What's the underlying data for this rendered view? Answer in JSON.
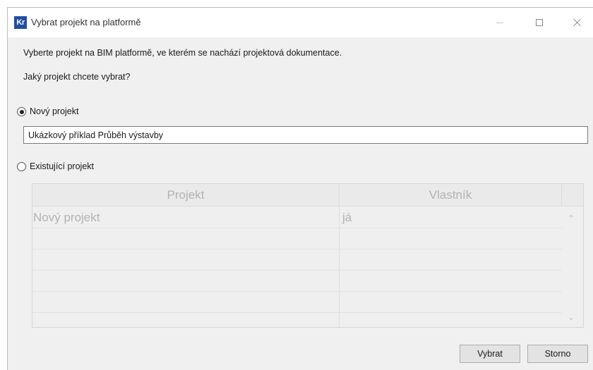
{
  "window": {
    "title": "Vybrat projekt na platformě",
    "logo_text": "Kr"
  },
  "description": "Vyberte projekt na BIM platformě, ve kterém se nachází projektová dokumentace.",
  "question": "Jaký projekt chcete vybrat?",
  "options": {
    "new_project": {
      "label": "Nový projekt",
      "selected": true
    },
    "existing_project": {
      "label": "Existující projekt",
      "selected": false
    }
  },
  "new_project_name": {
    "value": "Ukázkový příklad Průběh výstavby"
  },
  "table": {
    "columns": [
      "Projekt",
      "Vlastník"
    ],
    "rows": [
      [
        "Nový projekt",
        "já"
      ]
    ]
  },
  "buttons": {
    "select": "Vybrat",
    "cancel": "Storno"
  },
  "colors": {
    "logo_bg": "#1f4fa3",
    "disabled_text": "#b2b2b2"
  }
}
